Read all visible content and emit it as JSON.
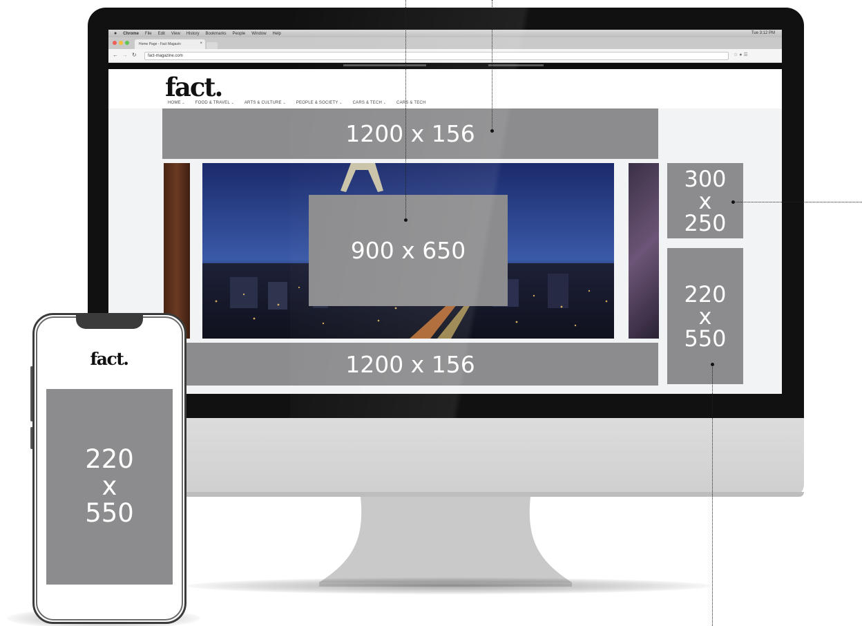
{
  "browser": {
    "menu_items": [
      "Chrome",
      "File",
      "Edit",
      "View",
      "History",
      "Bookmarks",
      "People",
      "Window",
      "Help"
    ],
    "clock": "Tue 3:12 PM",
    "tab_title": "Home Page - Fact Magazin",
    "url": "fact-magazine.com"
  },
  "site": {
    "logo": "fact.",
    "nav": [
      "HOME",
      "FOOD & TRAVEL",
      "ARTS & CULTURE",
      "PEOPLE & SOCIETY",
      "CARS & TECH",
      "CARS & TECH"
    ]
  },
  "ads": {
    "leaderboard_top": "1200 x 156",
    "hero": "900 x 650",
    "leaderboard_bottom": "1200 x 156",
    "sidebar_small": "300\nx\n250",
    "sidebar_tall": "220\nx\n550"
  },
  "mobile": {
    "logo": "fact.",
    "ad": "220\nx\n550"
  },
  "colors": {
    "ad_fill": "#8c8c8e",
    "bezel": "#111111",
    "chin": "#d6d6d6"
  }
}
